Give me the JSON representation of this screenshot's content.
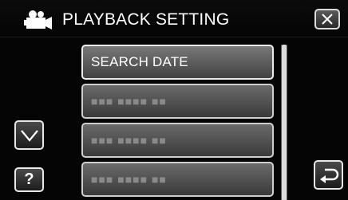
{
  "header": {
    "title": "PLAYBACK SETTING",
    "icon": "video-camera-icon",
    "close_icon": "close-icon"
  },
  "menu": {
    "items": [
      {
        "label": "SEARCH DATE",
        "active": true
      },
      {
        "label": "■■■ ■■■■ ■■",
        "active": false
      },
      {
        "label": "■■■ ■■■■ ■■",
        "active": false
      },
      {
        "label": "■■■ ■■■■ ■■",
        "active": false
      }
    ]
  },
  "controls": {
    "down_icon": "chevron-down-icon",
    "help_label": "?",
    "back_icon": "return-arrow-icon"
  },
  "scrollbar": {
    "position": 0.0
  }
}
